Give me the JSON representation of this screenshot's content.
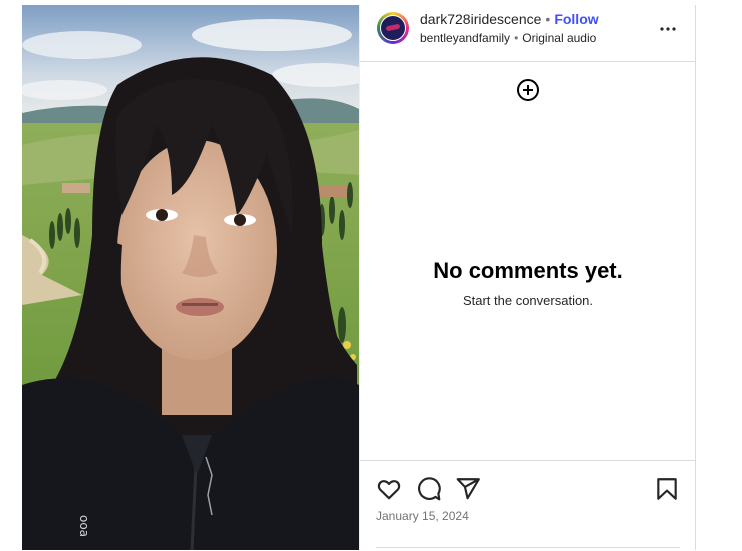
{
  "post": {
    "author": {
      "username": "dark728iridescence",
      "follow_label": "Follow",
      "separator": "•",
      "audio_source": "bentleyandfamily",
      "audio_label": "Original audio"
    },
    "comments": {
      "empty_title": "No comments yet.",
      "empty_subtitle": "Start the conversation."
    },
    "date": "January 15, 2024"
  },
  "icons": {
    "more": "more-horizontal-icon",
    "add": "plus-circle-icon",
    "like": "heart-icon",
    "comment": "comment-bubble-icon",
    "share": "paper-plane-icon",
    "save": "bookmark-icon"
  },
  "colors": {
    "follow": "#4150f7",
    "border": "#dbdbdb",
    "secondary_text": "#737373"
  }
}
